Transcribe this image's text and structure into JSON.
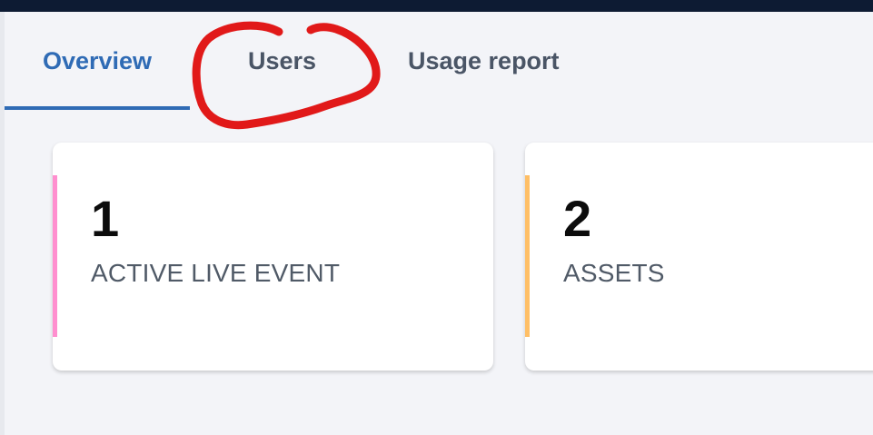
{
  "tabs": [
    {
      "label": "Overview",
      "active": true
    },
    {
      "label": "Users",
      "active": false
    },
    {
      "label": "Usage report",
      "active": false
    }
  ],
  "cards": [
    {
      "value": "1",
      "label": "ACTIVE LIVE EVENT",
      "accent_color": "#ff8fcf"
    },
    {
      "value": "2",
      "label": "ASSETS",
      "accent_color": "#ffbf66"
    }
  ],
  "colors": {
    "topbar": "#0d1b33",
    "background": "#f3f4f8",
    "active_tab": "#2f6bb5",
    "inactive_tab": "#4a5566",
    "annotation_stroke": "#e11919"
  },
  "annotation": {
    "shape": "hand-drawn-circle",
    "highlights": "Users"
  }
}
